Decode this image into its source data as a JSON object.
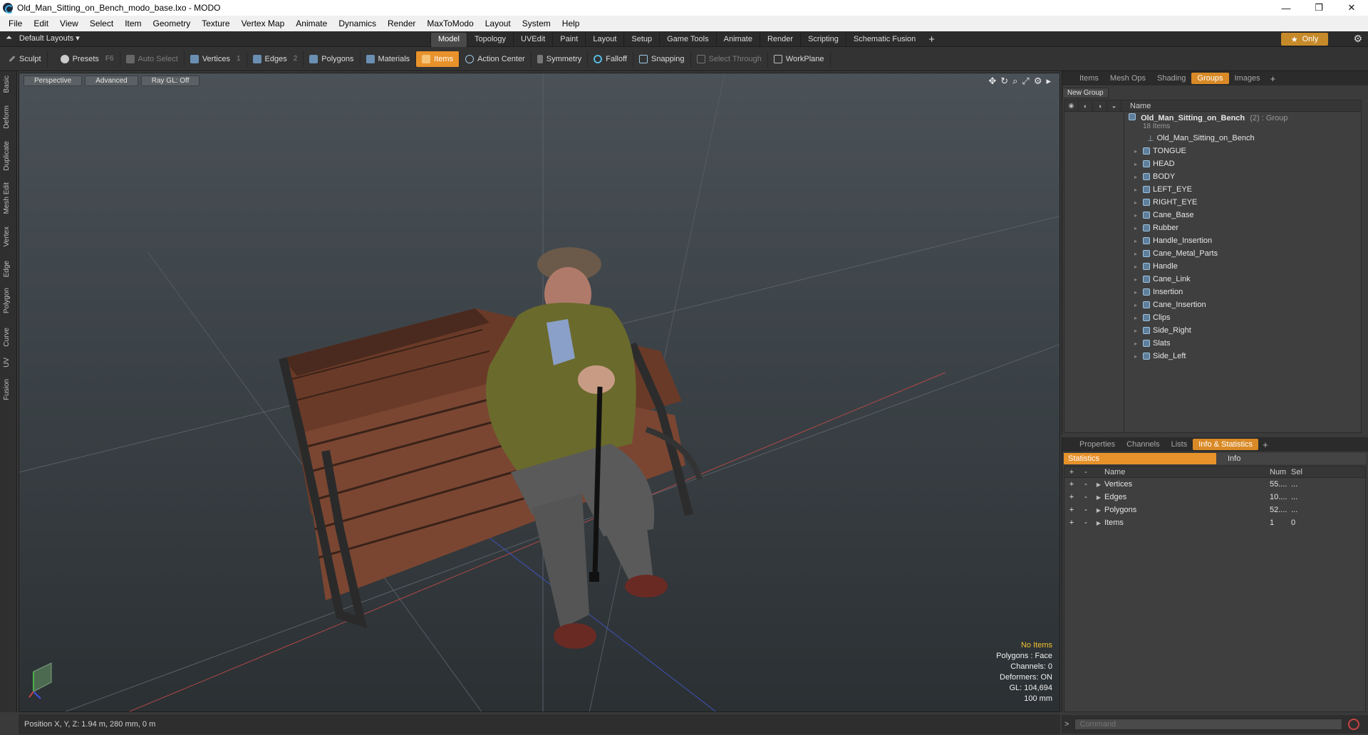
{
  "window": {
    "title": "Old_Man_Sitting_on_Bench_modo_base.lxo - MODO",
    "controls": [
      "—",
      "❐",
      "✕"
    ]
  },
  "menu": [
    "File",
    "Edit",
    "View",
    "Select",
    "Item",
    "Geometry",
    "Texture",
    "Vertex Map",
    "Animate",
    "Dynamics",
    "Render",
    "MaxToModo",
    "Layout",
    "System",
    "Help"
  ],
  "layoutbar": {
    "layout_label": "Default Layouts ▾",
    "tabs": [
      "Model",
      "Topology",
      "UVEdit",
      "Paint",
      "Layout",
      "Setup",
      "Game Tools",
      "Animate",
      "Render",
      "Scripting",
      "Schematic Fusion"
    ],
    "active_tab": "Model",
    "plus": "+",
    "only_label": "Only",
    "star": "★"
  },
  "toolbar": {
    "sculpt": "Sculpt",
    "presets": "Presets",
    "presets_key": "F6",
    "auto_select": "Auto Select",
    "vertices": "Vertices",
    "vertices_key": "1",
    "edges": "Edges",
    "edges_key": "2",
    "polygons": "Polygons",
    "materials": "Materials",
    "items": "Items",
    "action_center": "Action Center",
    "symmetry": "Symmetry",
    "falloff": "Falloff",
    "snapping": "Snapping",
    "select_through": "Select Through",
    "workplane": "WorkPlane"
  },
  "lefttabs": [
    "Basic",
    "Deform",
    "Duplicate",
    "Mesh Edit",
    "Vertex",
    "Edge",
    "Polygon",
    "Curve",
    "UV",
    "Fusion"
  ],
  "viewport": {
    "view": "Perspective",
    "shading": "Advanced",
    "raygl": "Ray GL: Off",
    "stats": {
      "no_items": "No Items",
      "polygons": "Polygons : Face",
      "channels": "Channels: 0",
      "deformers": "Deformers: ON",
      "gl": "GL: 104,694",
      "unit": "100 mm"
    }
  },
  "statusbar": {
    "position": "Position X, Y, Z:   1.94 m, 280 mm, 0 m"
  },
  "groups_panel": {
    "tabs": [
      "Items",
      "Mesh Ops",
      "Shading",
      "Groups",
      "Images"
    ],
    "active_tab": "Groups",
    "new_group": "New Group",
    "col_name": "Name",
    "group_name": "Old_Man_Sitting_on_Bench",
    "group_suffix": "(2) : Group",
    "group_count": "18 Items",
    "locator": "Old_Man_Sitting_on_Bench",
    "meshes": [
      "TONGUE",
      "HEAD",
      "BODY",
      "LEFT_EYE",
      "RIGHT_EYE",
      "Cane_Base",
      "Rubber",
      "Handle_Insertion",
      "Cane_Metal_Parts",
      "Handle",
      "Cane_Link",
      "Insertion",
      "Cane_Insertion",
      "Clips",
      "Side_Right",
      "Slats",
      "Side_Left"
    ]
  },
  "info_panel": {
    "tabs": [
      "Properties",
      "Channels",
      "Lists",
      "Info & Statistics"
    ],
    "active_tab": "Info & Statistics",
    "sub_statistics": "Statistics",
    "sub_info": "Info",
    "headers": {
      "name": "Name",
      "num": "Num",
      "sel": "Sel"
    },
    "rows": [
      {
        "name": "Vertices",
        "num": "55....",
        "sel": "..."
      },
      {
        "name": "Edges",
        "num": "10....",
        "sel": "..."
      },
      {
        "name": "Polygons",
        "num": "52....",
        "sel": "..."
      },
      {
        "name": "Items",
        "num": "1",
        "sel": "0"
      }
    ]
  },
  "command": {
    "prompt": ">",
    "placeholder": "Command"
  },
  "colors": {
    "accent": "#e8922b",
    "viewport_top": "#4a5157",
    "viewport_bottom": "#2b3033"
  }
}
